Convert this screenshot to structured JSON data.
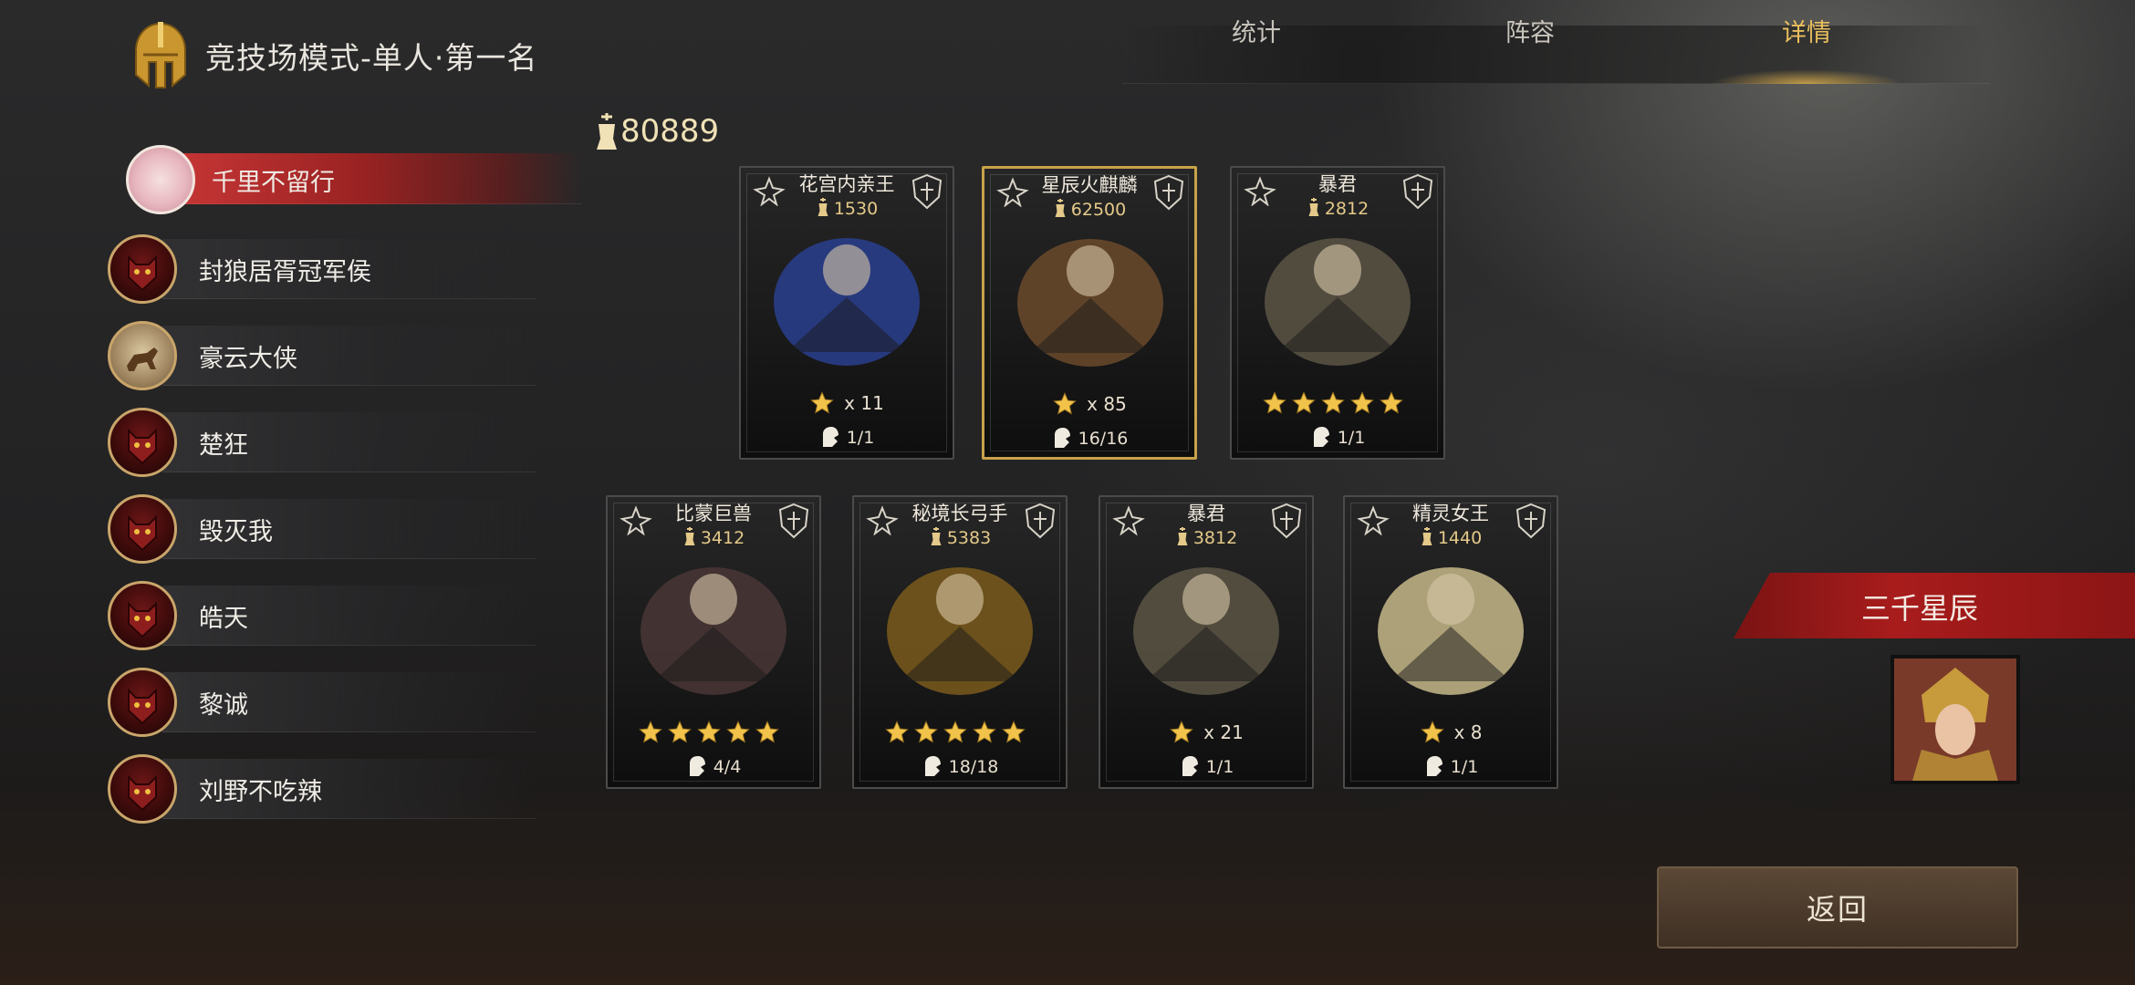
{
  "header": {
    "title": "竞技场模式-单人·第一名",
    "helmet_icon": "spartan-helmet-icon"
  },
  "tabs": [
    {
      "label": "统计",
      "active": false
    },
    {
      "label": "阵容",
      "active": false
    },
    {
      "label": "详情",
      "active": true
    }
  ],
  "players": [
    {
      "name": "千里不留行",
      "selected": true
    },
    {
      "name": "封狼居胥冠军侯",
      "selected": false
    },
    {
      "name": "豪云大侠",
      "selected": false
    },
    {
      "name": "楚狂",
      "selected": false
    },
    {
      "name": "毁灭我",
      "selected": false
    },
    {
      "name": "皓天",
      "selected": false
    },
    {
      "name": "黎诚",
      "selected": false
    },
    {
      "name": "刘野不吃辣",
      "selected": false
    }
  ],
  "total_power": "80889",
  "cards": [
    {
      "name": "花宫内亲王",
      "power": "1530",
      "stars": 1,
      "star_mult": "x 11",
      "count": "1/1",
      "highlight": false,
      "art_color": "#2a3f8f"
    },
    {
      "name": "星辰火麒麟",
      "power": "62500",
      "stars": 1,
      "star_mult": "x 85",
      "count": "16/16",
      "highlight": true,
      "art_color": "#6b4a2c"
    },
    {
      "name": "暴君",
      "power": "2812",
      "stars": 5,
      "star_mult": "",
      "count": "1/1",
      "highlight": false,
      "art_color": "#5c5545"
    },
    {
      "name": "比蒙巨兽",
      "power": "3412",
      "stars": 5,
      "star_mult": "",
      "count": "4/4",
      "highlight": false,
      "art_color": "#4a3636"
    },
    {
      "name": "秘境长弓手",
      "power": "5383",
      "stars": 5,
      "star_mult": "",
      "count": "18/18",
      "highlight": false,
      "art_color": "#7a5a1c"
    },
    {
      "name": "暴君",
      "power": "3812",
      "stars": 1,
      "star_mult": "x 21",
      "count": "1/1",
      "highlight": false,
      "art_color": "#5c5545"
    },
    {
      "name": "精灵女王",
      "power": "1440",
      "stars": 1,
      "star_mult": "x 8",
      "count": "1/1",
      "highlight": false,
      "art_color": "#c7b98a"
    }
  ],
  "opponent": {
    "name": "三千星辰"
  },
  "back_button": {
    "label": "返回"
  },
  "colors": {
    "accent_gold": "#e9bf5e",
    "selected_red": "#c53535",
    "banner_red": "#a81c1c"
  }
}
